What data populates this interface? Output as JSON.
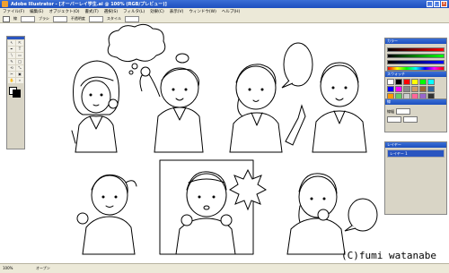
{
  "window": {
    "title": "Adobe Illustrator - [オーバーレイ学生.ai @ 100% (RGB/プレビュー)]",
    "min": "_",
    "max": "□",
    "close": "x"
  },
  "menu": [
    "ファイル(F)",
    "編集(E)",
    "オブジェクト(O)",
    "書式(T)",
    "選択(S)",
    "フィルタ(L)",
    "効果(C)",
    "表示(V)",
    "ウィンドウ(W)",
    "ヘルプ(H)"
  ],
  "control": {
    "stroke_label": "線",
    "brush_label": "ブラシ",
    "opacity_label": "不透明度",
    "style_label": "スタイル"
  },
  "panels": {
    "color_title": "カラー",
    "swatch_title": "スウォッチ",
    "stroke_title": "線",
    "stroke_weight_label": "線幅",
    "layers_title": "レイヤー",
    "layers": [
      "レイヤー 1"
    ]
  },
  "colors": {
    "titlebar": "#1d4fbe",
    "chrome": "#ece9d8",
    "panel": "#d9d5c6",
    "swatches": [
      "#ffffff",
      "#000000",
      "#ff0000",
      "#ffff00",
      "#00ff00",
      "#00ffff",
      "#0000ff",
      "#ff00ff",
      "#888888",
      "#cc9966",
      "#996633",
      "#336699",
      "#ff9900",
      "#66cc66",
      "#cccccc",
      "#ff6699",
      "#9966cc",
      "#333333"
    ]
  },
  "tools": [
    "↖",
    "⇱",
    "✒",
    "T",
    "\\",
    "▭",
    "✎",
    "◯",
    "⟲",
    "⤡",
    "✂",
    "▣",
    "✋",
    "⌕"
  ],
  "status": {
    "zoom": "100%",
    "text": "オープン"
  },
  "credit": "(C)fumi watanabe"
}
